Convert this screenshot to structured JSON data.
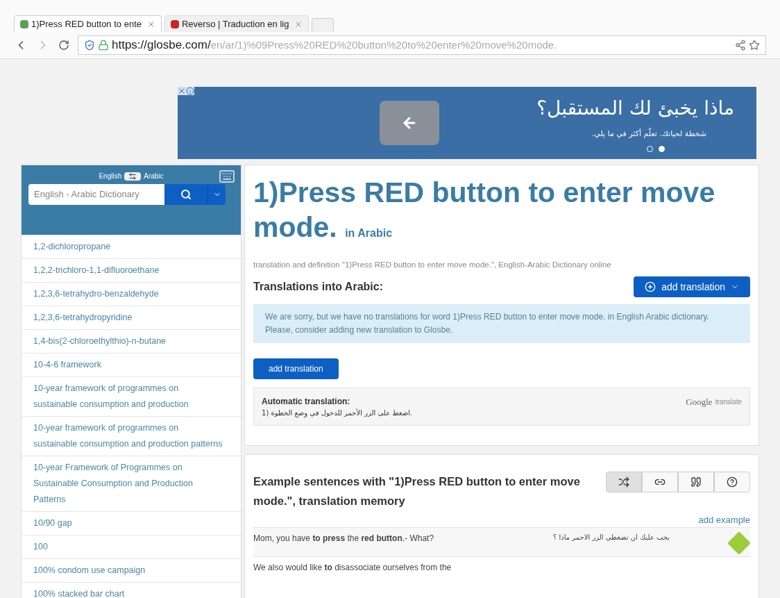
{
  "browser": {
    "tabs": [
      {
        "title": "1)Press RED button to ente",
        "selected": true
      },
      {
        "title": "Reverso | Traduction en lig",
        "selected": false
      }
    ],
    "url_host": "https://glosbe.com/",
    "url_path": "en/ar/1)%09Press%20RED%20button%20to%20enter%20move%20mode."
  },
  "ad": {
    "headline": "ماذا يخبئ لك المستقبل؟",
    "subline": "شخطة لحياتك. تعلّم أكثر في ما يلي.",
    "dots": [
      {
        "selected": false
      },
      {
        "selected": true
      }
    ]
  },
  "sidebar": {
    "lang_from": "English",
    "lang_to": "Arabic",
    "search_placeholder": "English - Arabic Dictionary",
    "items": [
      "1,2-dichloropropane",
      "1,2,2-trichloro-1,1-difluoroethane",
      "1,2,3,6-tetrahydro-benzaldehyde",
      "1,2,3,6-tetrahydropyridine",
      "1,4-bis(2-chloroethylthio)-n-butane",
      "10-4-6 framework",
      "10-year framework of programmes on sustainable consumption and production",
      "10-year framework of programmes on sustainable consumption and production patterns",
      "10-year Framework of Programmes on Sustainable Consumption and Production Patterns",
      "10/90 gap",
      "100",
      "100% condom use campaign",
      "100% stacked bar chart"
    ]
  },
  "main": {
    "title": "1)Press RED button to enter move mode.",
    "title_suffix": "in Arabic",
    "subtitle": "translation and definition \"1)Press RED button to enter move mode.\", English-Arabic Dictionary  online",
    "translations_heading": "Translations into Arabic:",
    "add_translation_dropdown": "add translation",
    "notice": "We are sorry, but we have no translations for word 1)Press RED button to enter move mode. in English Arabic dictionary. Please, consider adding new translation to Glosbe.",
    "add_translation_button": "add translation",
    "auto_label": "Automatic translation:",
    "auto_text": ".اضغط على الزر الأحمر للدخول في وضع الخطوة (1",
    "google_brand": "Google",
    "google_suffix": "translate"
  },
  "examples": {
    "heading": "Example sentences with \"1)Press RED button to enter move mode.\", translation memory",
    "view_buttons": [
      {
        "selected": true
      },
      {
        "selected": false
      },
      {
        "selected": false
      },
      {
        "selected": false
      }
    ],
    "add_example": "add example",
    "rows": [
      {
        "english": "Mom, you have **to press** the **red button**.- What?",
        "arabic": "يجب عليك ان تضغطي الزر الاحمر ماذا ؟"
      },
      {
        "english": "We also would like **to** disassociate ourselves from the",
        "arabic": ""
      }
    ]
  }
}
